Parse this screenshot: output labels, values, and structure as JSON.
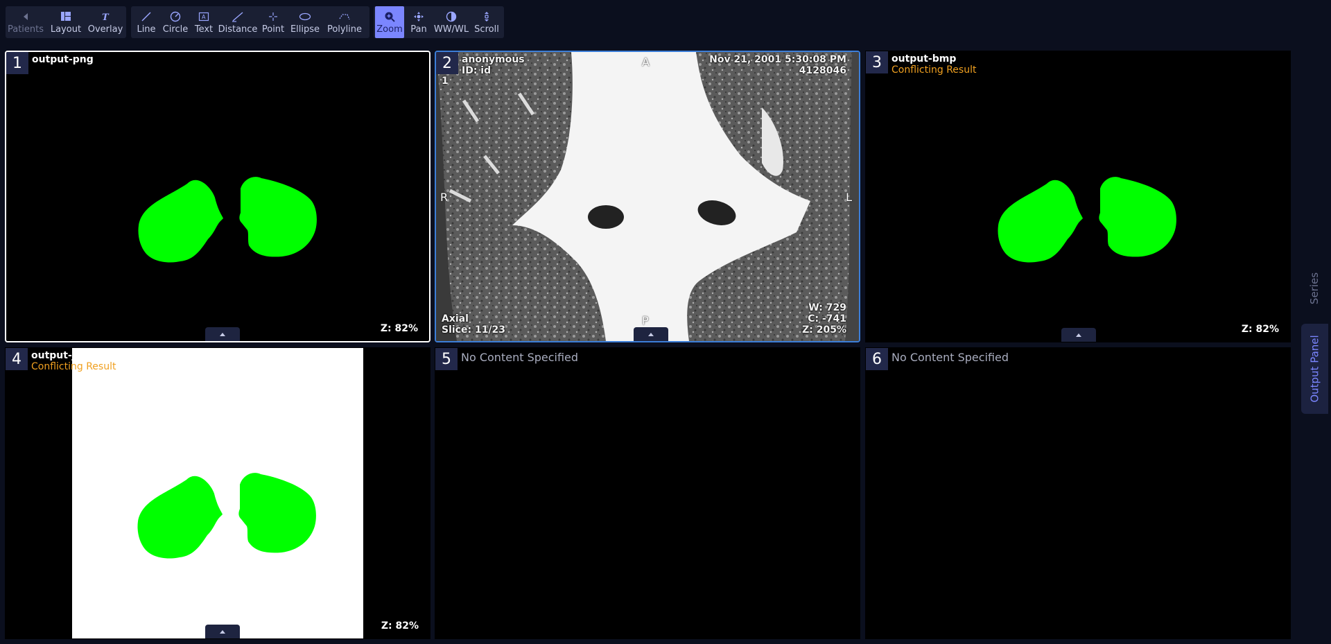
{
  "toolbar": {
    "nav": [
      {
        "label": "Patients",
        "icon": "chevron-left-icon",
        "disabled": true
      },
      {
        "label": "Layout",
        "icon": "layout-grid-icon"
      },
      {
        "label": "Overlay",
        "icon": "overlay-text-icon"
      }
    ],
    "annotate": [
      {
        "label": "Line",
        "icon": "line-icon"
      },
      {
        "label": "Circle",
        "icon": "circle-icon"
      },
      {
        "label": "Text",
        "icon": "text-box-icon"
      },
      {
        "label": "Distance",
        "icon": "distance-icon"
      },
      {
        "label": "Point",
        "icon": "point-icon"
      },
      {
        "label": "Ellipse",
        "icon": "ellipse-icon"
      },
      {
        "label": "Polyline",
        "icon": "polyline-icon"
      }
    ],
    "view": [
      {
        "label": "Zoom",
        "icon": "zoom-icon",
        "active": true
      },
      {
        "label": "Pan",
        "icon": "pan-icon"
      },
      {
        "label": "WW/WL",
        "icon": "contrast-icon"
      },
      {
        "label": "Scroll",
        "icon": "scroll-icon"
      }
    ]
  },
  "viewports": {
    "v1": {
      "number": "1",
      "title": "output-png",
      "zoom": "Z: 82%"
    },
    "v2": {
      "number": "2",
      "patient": "anonymous",
      "patient_id": "ID: id",
      "datetime": "Nov 21, 2001 5:30:08 PM",
      "accession": "4128046",
      "image_num": "1",
      "orient_top": "A",
      "orient_bottom": "P",
      "orient_left": "R",
      "orient_right": "L",
      "plane": "Axial",
      "slice": "Slice: 11/23",
      "window": "W: 729",
      "center": "C: -741",
      "zoom": "Z: 205%"
    },
    "v3": {
      "number": "3",
      "title": "output-bmp",
      "status": "Conflicting Result",
      "zoom": "Z: 82%"
    },
    "v4": {
      "number": "4",
      "title": "output-jpeg",
      "status": "Conflicting Result",
      "zoom": "Z: 82%"
    },
    "v5": {
      "number": "5",
      "message": "No Content Specified"
    },
    "v6": {
      "number": "6",
      "message": "No Content Specified"
    }
  },
  "sidebar": {
    "tabs": [
      {
        "label": "Series",
        "active": false
      },
      {
        "label": "Output Panel",
        "active": true
      }
    ]
  },
  "colors": {
    "background": "#0b0f1e",
    "toolbar_group": "#1a1f33",
    "active_tool": "#7b86ff",
    "mask_green": "#00ff00",
    "warning_orange": "#f0a020",
    "active_viewport_border": "#3c7ed8"
  }
}
